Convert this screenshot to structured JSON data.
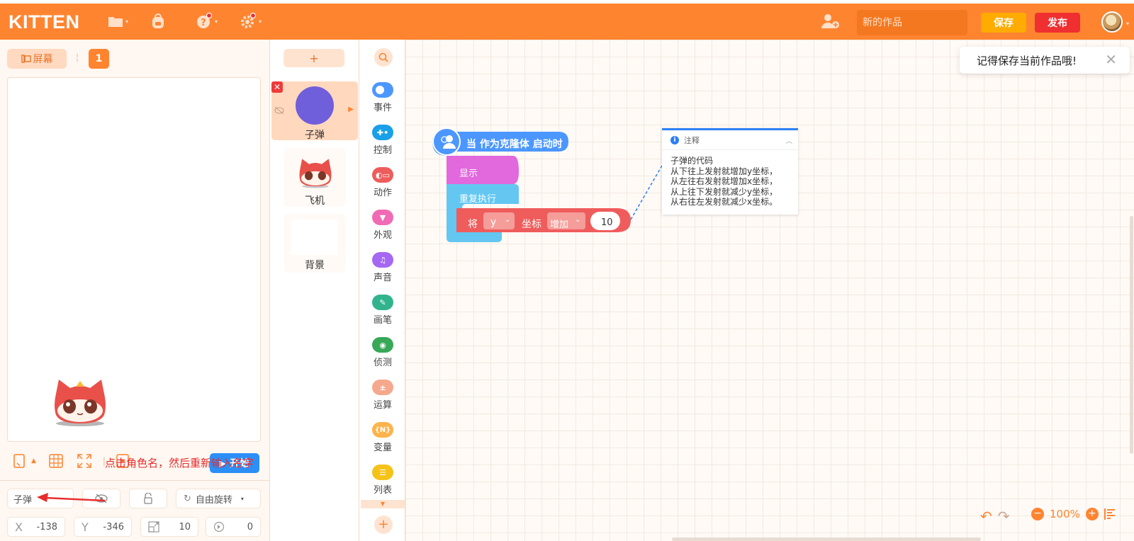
{
  "app": {
    "logo": "KITTEN"
  },
  "header": {
    "menu_icons": [
      "folder-icon",
      "backpack-icon",
      "help-icon",
      "settings-icon"
    ],
    "title_placeholder": "新的作品",
    "save_label": "保存",
    "publish_label": "发布",
    "colors": {
      "bar": "#ff8430",
      "save": "#ffab00",
      "publish": "#ef2f30"
    }
  },
  "stage": {
    "screen_label": "屏幕",
    "scene_number": "1",
    "start_label": "开始",
    "sprite_name": "子弹",
    "rotation_mode": "自由旋转",
    "x_label": "X",
    "x_value": "-138",
    "y_label": "Y",
    "y_value": "-346",
    "size_value": "10",
    "direction_value": "0"
  },
  "annotation": {
    "text": "点击角色名，然后重新输入名字"
  },
  "sprites": {
    "add_label": "+",
    "items": [
      {
        "name": "子弹",
        "active": true
      },
      {
        "name": "飞机",
        "active": false
      },
      {
        "name": "背景",
        "active": false
      }
    ]
  },
  "categories": [
    {
      "label": "事件",
      "color": "#4c97ff"
    },
    {
      "label": "控制",
      "color": "#1aa0e8"
    },
    {
      "label": "动作",
      "color": "#ef5c5c"
    },
    {
      "label": "外观",
      "color": "#f06ab4"
    },
    {
      "label": "声音",
      "color": "#a568f2"
    },
    {
      "label": "画笔",
      "color": "#31b48d"
    },
    {
      "label": "侦测",
      "color": "#38a858"
    },
    {
      "label": "运算",
      "color": "#f5a88d"
    },
    {
      "label": "变量",
      "color": "#ffb34c"
    },
    {
      "label": "列表",
      "color": "#f5c219"
    }
  ],
  "blocks": {
    "hat_label": "当 作为克隆体 启动时",
    "show_label": "显示",
    "repeat_label": "重复执行",
    "set_label": "将",
    "axis_value": "y",
    "coord_label": "坐标",
    "op_value": "增加",
    "amount": "10"
  },
  "comment": {
    "title": "注释",
    "body": "子弹的代码\n从下往上发射就增加y坐标，\n从左往右发射就增加x坐标，\n从上往下发射就减少y坐标，\n从右往左发射就减少x坐标。"
  },
  "toast": {
    "text": "记得保存当前作品哦!"
  },
  "zoom": {
    "level": "100%"
  }
}
